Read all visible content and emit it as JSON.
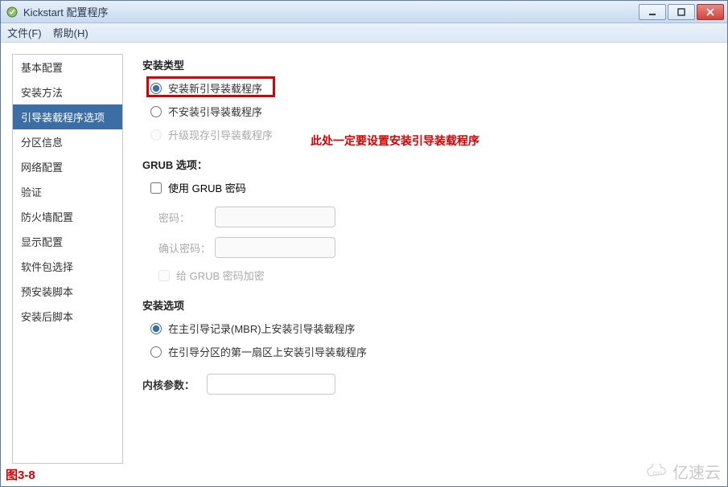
{
  "window": {
    "title": "Kickstart 配置程序"
  },
  "menubar": {
    "file": "文件(F)",
    "help": "帮助(H)"
  },
  "sidebar": {
    "items": [
      {
        "label": "基本配置",
        "selected": false
      },
      {
        "label": "安装方法",
        "selected": false
      },
      {
        "label": "引导装载程序选项",
        "selected": true
      },
      {
        "label": "分区信息",
        "selected": false
      },
      {
        "label": "网络配置",
        "selected": false
      },
      {
        "label": "验证",
        "selected": false
      },
      {
        "label": "防火墙配置",
        "selected": false
      },
      {
        "label": "显示配置",
        "selected": false
      },
      {
        "label": "软件包选择",
        "selected": false
      },
      {
        "label": "预安装脚本",
        "selected": false
      },
      {
        "label": "安装后脚本",
        "selected": false
      }
    ]
  },
  "main": {
    "install_type": {
      "title": "安装类型",
      "options": {
        "new": "安装新引导装载程序",
        "none": "不安装引导装载程序",
        "upgrade": "升级现存引导装载程序"
      },
      "selected": "new",
      "note": "此处一定要设置安装引导装载程序"
    },
    "grub": {
      "title": "GRUB 选项：",
      "use_password_label": "使用 GRUB 密码",
      "use_password_checked": false,
      "password_label": "密码：",
      "confirm_label": "确认密码：",
      "encrypt_label": "给 GRUB 密码加密",
      "encrypt_checked": false
    },
    "install_opts": {
      "title": "安装选项",
      "mbr": "在主引导记录(MBR)上安装引导装载程序",
      "first_sector": "在引导分区的第一扇区上安装引导装载程序",
      "selected": "mbr"
    },
    "kernel": {
      "label": "内核参数：",
      "value": ""
    }
  },
  "figure_label": "图3-8",
  "watermark": "亿速云"
}
